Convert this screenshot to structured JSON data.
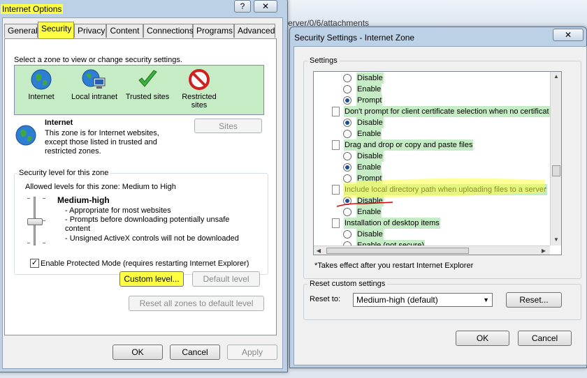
{
  "background": {
    "url_fragment": "erver/0/6/attachments"
  },
  "internet_options": {
    "title": "Internet Options",
    "help_button": "?",
    "close_button": "✕",
    "tabs": [
      "General",
      "Security",
      "Privacy",
      "Content",
      "Connections",
      "Programs",
      "Advanced"
    ],
    "active_tab": "Security",
    "zone_prompt": "Select a zone to view or change security settings.",
    "zones": [
      {
        "label": "Internet",
        "icon": "globe-icon"
      },
      {
        "label": "Local intranet",
        "icon": "intranet-icon"
      },
      {
        "label": "Trusted sites",
        "icon": "checkmark-icon"
      },
      {
        "label": "Restricted sites",
        "icon": "restricted-icon"
      }
    ],
    "zone_title": "Internet",
    "zone_description": "This zone is for Internet websites, except those listed in trusted and restricted zones.",
    "sites_button": "Sites",
    "security_group_label": "Security level for this zone",
    "allowed_levels": "Allowed levels for this zone: Medium to High",
    "level_name": "Medium-high",
    "level_bullets": [
      "- Appropriate for most websites",
      "- Prompts before downloading potentially unsafe content",
      "- Unsigned ActiveX controls will not be downloaded"
    ],
    "protected_mode_label": "Enable Protected Mode (requires restarting Internet Explorer)",
    "protected_mode_checked": true,
    "custom_level_button": "Custom level...",
    "default_level_button": "Default level",
    "reset_all_button": "Reset all zones to default level",
    "ok_button": "OK",
    "cancel_button": "Cancel",
    "apply_button": "Apply"
  },
  "security_settings": {
    "title": "Security Settings - Internet Zone",
    "close_button": "✕",
    "settings_label": "Settings",
    "rows": [
      {
        "kind": "option",
        "label": "Disable",
        "selected": false
      },
      {
        "kind": "option",
        "label": "Enable",
        "selected": false
      },
      {
        "kind": "option",
        "label": "Prompt",
        "selected": true
      },
      {
        "kind": "heading",
        "label": "Don't prompt for client certificate selection when no certificat"
      },
      {
        "kind": "option",
        "label": "Disable",
        "selected": true
      },
      {
        "kind": "option",
        "label": "Enable",
        "selected": false
      },
      {
        "kind": "heading",
        "label": "Drag and drop or copy and paste files"
      },
      {
        "kind": "option",
        "label": "Disable",
        "selected": false
      },
      {
        "kind": "option",
        "label": "Enable",
        "selected": true
      },
      {
        "kind": "option",
        "label": "Prompt",
        "selected": false
      },
      {
        "kind": "heading",
        "label": "Include local directory path when uploading files to a server"
      },
      {
        "kind": "option",
        "label": "Disable",
        "selected": true
      },
      {
        "kind": "option",
        "label": "Enable",
        "selected": false
      },
      {
        "kind": "heading",
        "label": "Installation of desktop items"
      },
      {
        "kind": "option",
        "label": "Disable",
        "selected": false
      },
      {
        "kind": "option",
        "label": "Enable (not secure)",
        "selected": false
      }
    ],
    "restart_note": "*Takes effect after you restart Internet Explorer",
    "reset_group_label": "Reset custom settings",
    "reset_to_label": "Reset to:",
    "reset_to_value": "Medium-high (default)",
    "reset_button": "Reset...",
    "ok_button": "OK",
    "cancel_button": "Cancel"
  },
  "colors": {
    "highlight": "#ffff44",
    "zone_bg": "#c6ecc6",
    "annotation_red": "#e00000"
  }
}
